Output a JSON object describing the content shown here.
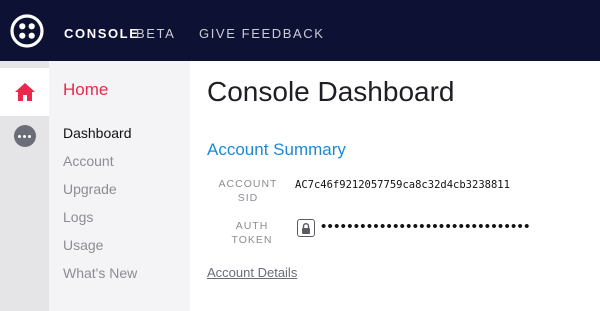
{
  "topbar": {
    "console": "CONSOLE",
    "beta": "BETA",
    "feedback": "GIVE FEEDBACK"
  },
  "icons": {
    "logo": "twilio-logo-icon",
    "home": "home-icon",
    "more": "more-icon",
    "lock": "lock-icon"
  },
  "colors": {
    "topbar_bg": "#0d1133",
    "brand_red": "#e8294c",
    "link_blue": "#1b8ad6"
  },
  "sidebar": {
    "title": "Home",
    "items": [
      {
        "label": "Dashboard",
        "active": true
      },
      {
        "label": "Account",
        "active": false
      },
      {
        "label": "Upgrade",
        "active": false
      },
      {
        "label": "Logs",
        "active": false
      },
      {
        "label": "Usage",
        "active": false
      },
      {
        "label": "What's New",
        "active": false
      }
    ]
  },
  "main": {
    "title": "Console Dashboard",
    "section_title": "Account Summary",
    "account_sid": {
      "label_line1": "ACCOUNT",
      "label_line2": "SID",
      "value": "AC7c46f9212057759ca8c32d4cb3238811"
    },
    "auth_token": {
      "label_line1": "AUTH",
      "label_line2": "TOKEN",
      "masked": "••••••••••••••••••••••••••••••••"
    },
    "details_link": "Account Details"
  }
}
